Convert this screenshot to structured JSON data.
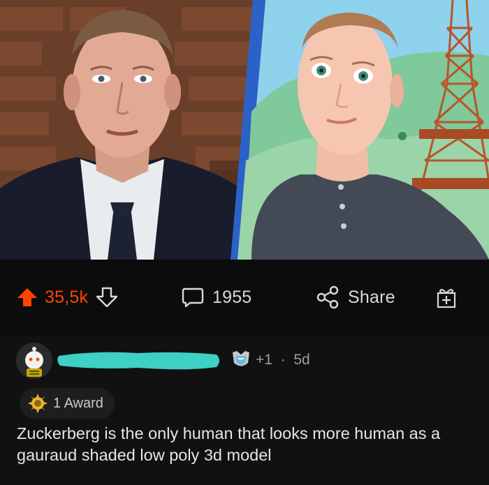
{
  "post": {
    "image": {
      "left_panel": "real-photo",
      "right_panel": "vr-avatar"
    },
    "actions": {
      "score": "35,5k",
      "comments_count": "1955",
      "share_label": "Share"
    }
  },
  "comment": {
    "username": "",
    "flair_count": "+1",
    "age": "5d",
    "award_label": "1 Award",
    "body": "Zuckerberg is the only human that looks more human as a gauraud shaded low poly 3d model"
  },
  "colors": {
    "upvote": "#ff4500",
    "redaction": "#3ed0c4",
    "background": "#0b0b0b"
  },
  "icons": [
    "upvote-arrow-icon",
    "downvote-arrow-icon",
    "comment-bubble-icon",
    "share-icon",
    "award-icon",
    "silver-award-icon"
  ]
}
